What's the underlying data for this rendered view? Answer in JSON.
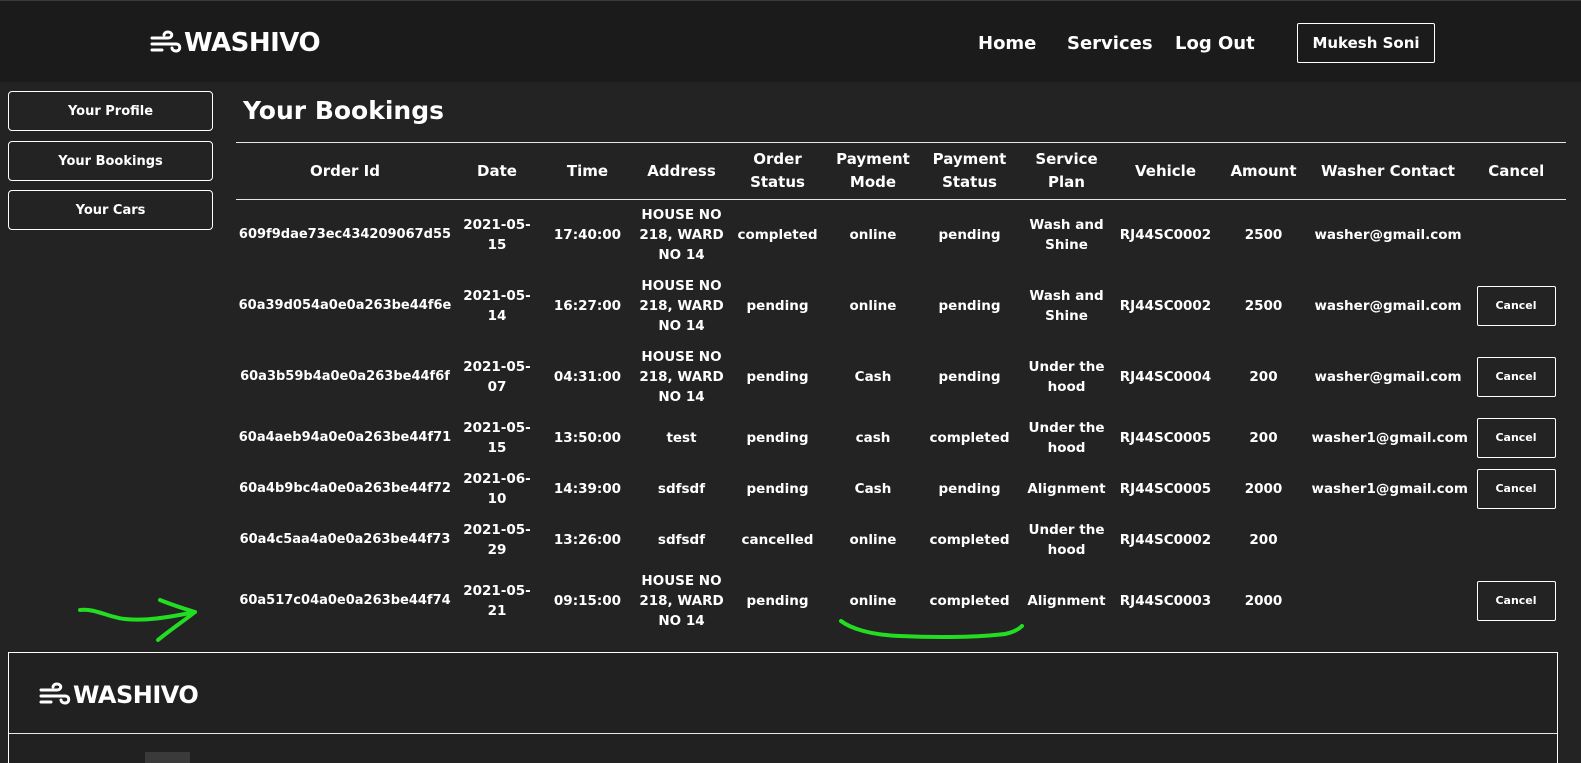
{
  "brand": {
    "name": "WASHIVO",
    "icon": "wind-icon"
  },
  "nav": {
    "home": "Home",
    "services": "Services",
    "logout": "Log Out",
    "user": "Mukesh Soni"
  },
  "sidebar": {
    "items": [
      {
        "label": "Your Profile"
      },
      {
        "label": "Your Bookings"
      },
      {
        "label": "Your Cars"
      }
    ]
  },
  "page": {
    "title": "Your Bookings"
  },
  "table": {
    "headers": [
      "Order Id",
      "Date",
      "Time",
      "Address",
      "Order Status",
      "Payment Mode",
      "Payment Status",
      "Service Plan",
      "Vehicle",
      "Amount",
      "Washer Contact",
      "Cancel"
    ],
    "cancel_label": "Cancel",
    "rows": [
      {
        "order_id": "609f9dae73ec434209067d55",
        "date": "2021-05-15",
        "time": "17:40:00",
        "address": "HOUSE NO 218, WARD NO 14",
        "order_status": "completed",
        "payment_mode": "online",
        "payment_status": "pending",
        "service_plan": "Wash and Shine",
        "vehicle": "RJ44SC0002",
        "amount": "2500",
        "washer_contact": "washer@gmail.com",
        "cancellable": false
      },
      {
        "order_id": "60a39d054a0e0a263be44f6e",
        "date": "2021-05-14",
        "time": "16:27:00",
        "address": "HOUSE NO 218, WARD NO 14",
        "order_status": "pending",
        "payment_mode": "online",
        "payment_status": "pending",
        "service_plan": "Wash and Shine",
        "vehicle": "RJ44SC0002",
        "amount": "2500",
        "washer_contact": "washer@gmail.com",
        "cancellable": true
      },
      {
        "order_id": "60a3b59b4a0e0a263be44f6f",
        "date": "2021-05-07",
        "time": "04:31:00",
        "address": "HOUSE NO 218, WARD NO 14",
        "order_status": "pending",
        "payment_mode": "Cash",
        "payment_status": "pending",
        "service_plan": "Under the hood",
        "vehicle": "RJ44SC0004",
        "amount": "200",
        "washer_contact": "washer@gmail.com",
        "cancellable": true
      },
      {
        "order_id": "60a4aeb94a0e0a263be44f71",
        "date": "2021-05-15",
        "time": "13:50:00",
        "address": "test",
        "order_status": "pending",
        "payment_mode": "cash",
        "payment_status": "completed",
        "service_plan": "Under the hood",
        "vehicle": "RJ44SC0005",
        "amount": "200",
        "washer_contact": "washer1@gmail.com",
        "cancellable": true
      },
      {
        "order_id": "60a4b9bc4a0e0a263be44f72",
        "date": "2021-06-10",
        "time": "14:39:00",
        "address": "sdfsdf",
        "order_status": "pending",
        "payment_mode": "Cash",
        "payment_status": "pending",
        "service_plan": "Alignment",
        "vehicle": "RJ44SC0005",
        "amount": "2000",
        "washer_contact": "washer1@gmail.com",
        "cancellable": true
      },
      {
        "order_id": "60a4c5aa4a0e0a263be44f73",
        "date": "2021-05-29",
        "time": "13:26:00",
        "address": "sdfsdf",
        "order_status": "cancelled",
        "payment_mode": "online",
        "payment_status": "completed",
        "service_plan": "Under the hood",
        "vehicle": "RJ44SC0002",
        "amount": "200",
        "washer_contact": "",
        "cancellable": false
      },
      {
        "order_id": "60a517c04a0e0a263be44f74",
        "date": "2021-05-21",
        "time": "09:15:00",
        "address": "HOUSE NO 218, WARD NO 14",
        "order_status": "pending",
        "payment_mode": "online",
        "payment_status": "completed",
        "service_plan": "Alignment",
        "vehicle": "RJ44SC0003",
        "amount": "2000",
        "washer_contact": "",
        "cancellable": true
      }
    ]
  },
  "footer": {
    "brand": "WASHIVO"
  },
  "colors": {
    "background": "#232323",
    "navbar": "#1b1b1b",
    "annotation": "#22dd22"
  }
}
